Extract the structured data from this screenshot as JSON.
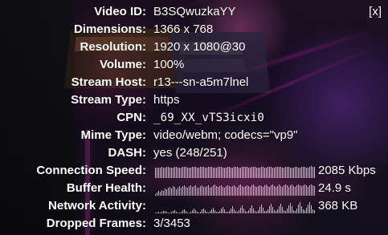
{
  "panel": {
    "close_label": "[x]"
  },
  "stats": [
    {
      "label": "Video ID:",
      "value": "B3SQwuzkaYY"
    },
    {
      "label": "Dimensions:",
      "value": "1366 x 768"
    },
    {
      "label": "Resolution:",
      "value": "1920 x 1080@30"
    },
    {
      "label": "Volume:",
      "value": "100%"
    },
    {
      "label": "Stream Host:",
      "value": "r13---sn-a5m7lnel"
    },
    {
      "label": "Stream Type:",
      "value": "https"
    },
    {
      "label": "CPN:",
      "value": "_69_XX_vTS3icxi0"
    },
    {
      "label": "Mime Type:",
      "value": "video/webm; codecs=\"vp9\""
    },
    {
      "label": "DASH:",
      "value": "yes (248/251)"
    },
    {
      "label": "Connection Speed:",
      "value": "2085 Kbps"
    },
    {
      "label": "Buffer Health:",
      "value": "24.9 s"
    },
    {
      "label": "Network Activity:",
      "value": "368 KB"
    },
    {
      "label": "Dropped Frames:",
      "value": "3/3453"
    }
  ],
  "graphs": {
    "connection_speed": [
      0.74,
      0.78,
      0.76,
      0.79,
      0.81,
      0.77,
      0.75,
      0.8,
      0.82,
      0.78,
      0.76,
      0.79,
      0.83,
      0.81,
      0.77,
      0.74,
      0.78,
      0.82,
      0.84,
      0.8,
      0.77,
      0.75,
      0.79,
      0.83,
      0.85,
      0.81,
      0.78,
      0.76,
      0.8,
      0.84,
      0.82,
      0.79,
      0.77,
      0.81,
      0.85,
      0.83,
      0.79,
      0.76,
      0.78,
      0.82,
      0.84,
      0.8,
      0.77,
      0.75,
      0.79,
      0.83,
      0.81,
      0.78,
      0.76,
      0.8,
      0.84,
      0.82,
      0.79,
      0.77,
      0.81,
      0.85,
      0.83,
      0.8,
      0.76,
      0.78,
      0.82,
      0.84,
      0.81,
      0.77,
      0.75,
      0.79,
      0.83,
      0.82,
      0.78,
      0.76,
      0.8,
      0.84,
      0.83,
      0.79,
      0.77,
      0.81,
      0.85,
      0.84,
      0.8,
      0.76,
      0.78,
      0.83,
      0.85,
      0.81,
      0.77,
      0.75,
      0.79,
      0.84,
      0.82,
      0.78,
      0.76,
      0.8,
      0.85,
      0.83,
      0.79,
      0.77,
      0.81,
      0.86,
      0.84,
      0.8
    ],
    "buffer_health": [
      0.14,
      0.21,
      0.33,
      0.27,
      0.44,
      0.36,
      0.52,
      0.47,
      0.58,
      0.63,
      0.55,
      0.71,
      0.66,
      0.49,
      0.61,
      0.72,
      0.56,
      0.68,
      0.74,
      0.63,
      0.58,
      0.7,
      0.77,
      0.64,
      0.69,
      0.75,
      0.61,
      0.57,
      0.73,
      0.79,
      0.67,
      0.62,
      0.71,
      0.76,
      0.6,
      0.65,
      0.74,
      0.8,
      0.68,
      0.63,
      0.72,
      0.78,
      0.66,
      0.6,
      0.73,
      0.79,
      0.69,
      0.62,
      0.71,
      0.77,
      0.67,
      0.61,
      0.74,
      0.8,
      0.7,
      0.64,
      0.72,
      0.78,
      0.69,
      0.63,
      0.75,
      0.81,
      0.71,
      0.65,
      0.73,
      0.79,
      0.7,
      0.62,
      0.74,
      0.8,
      0.72,
      0.66,
      0.75,
      0.82,
      0.71,
      0.64,
      0.73,
      0.8,
      0.72,
      0.66,
      0.76,
      0.83,
      0.74,
      0.67,
      0.75,
      0.81,
      0.73,
      0.65,
      0.77,
      0.84,
      0.75,
      0.68,
      0.76,
      0.82,
      0.74,
      0.67,
      0.78,
      0.85,
      0.76,
      0.7
    ],
    "network_activity": [
      0.05,
      0.08,
      0.12,
      0.07,
      0.1,
      0.2,
      0.15,
      0.09,
      0.04,
      0.06,
      0.11,
      0.18,
      0.24,
      0.14,
      0.08,
      0.05,
      0.1,
      0.22,
      0.3,
      0.16,
      0.07,
      0.06,
      0.12,
      0.26,
      0.34,
      0.21,
      0.1,
      0.07,
      0.14,
      0.28,
      0.36,
      0.22,
      0.11,
      0.08,
      0.16,
      0.31,
      0.4,
      0.23,
      0.12,
      0.09,
      0.18,
      0.33,
      0.46,
      0.28,
      0.14,
      0.1,
      0.2,
      0.37,
      0.5,
      0.3,
      0.15,
      0.12,
      0.22,
      0.4,
      0.56,
      0.34,
      0.16,
      0.13,
      0.24,
      0.43,
      0.6,
      0.38,
      0.18,
      0.14,
      0.26,
      0.47,
      0.64,
      0.42,
      0.2,
      0.15,
      0.29,
      0.5,
      0.69,
      0.45,
      0.22,
      0.17,
      0.31,
      0.54,
      0.72,
      0.48,
      0.24,
      0.19,
      0.33,
      0.58,
      0.76,
      0.51,
      0.26,
      0.2,
      0.36,
      0.62,
      0.8,
      0.55,
      0.28,
      0.22,
      0.39,
      0.66,
      0.84,
      0.58,
      0.3,
      0.24
    ]
  }
}
